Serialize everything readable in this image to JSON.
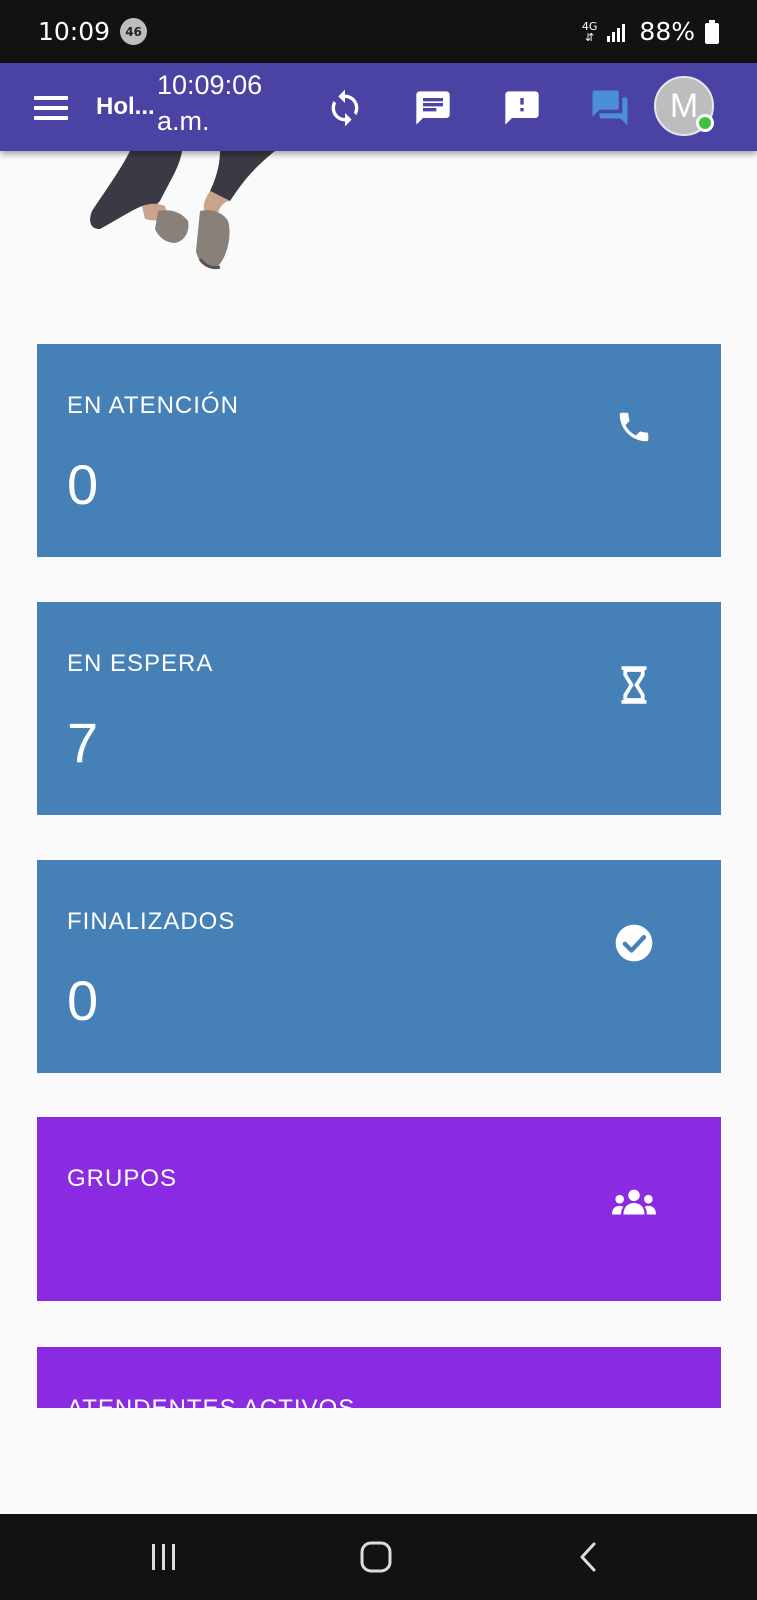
{
  "status_bar": {
    "time": "10:09",
    "badge": "46",
    "network": "4G",
    "battery": "88%"
  },
  "app_bar": {
    "title": "Hol...",
    "clock_time": "10:09:06",
    "clock_period": "a.m.",
    "avatar_initial": "M",
    "icons": [
      "menu-icon",
      "sync-icon",
      "message-icon",
      "alert-message-icon",
      "forum-icon"
    ]
  },
  "cards": [
    {
      "label": "EN ATENCIÓN",
      "value": "0",
      "icon": "phone-icon",
      "color": "#4580b7"
    },
    {
      "label": "EN ESPERA",
      "value": "7",
      "icon": "hourglass-icon",
      "color": "#4580b7"
    },
    {
      "label": "FINALIZADOS",
      "value": "0",
      "icon": "check-circle-icon",
      "color": "#4580b7"
    },
    {
      "label": "GRUPOS",
      "icon": "groups-icon",
      "color": "#8a2be2"
    },
    {
      "label": "ATENDENTES ACTIVOS",
      "color": "#8a2be2"
    }
  ],
  "colors": {
    "app_bar": "#4a43a3",
    "card_blue": "#4580b7",
    "card_purple": "#8a2be2",
    "presence": "#3cc23c"
  }
}
